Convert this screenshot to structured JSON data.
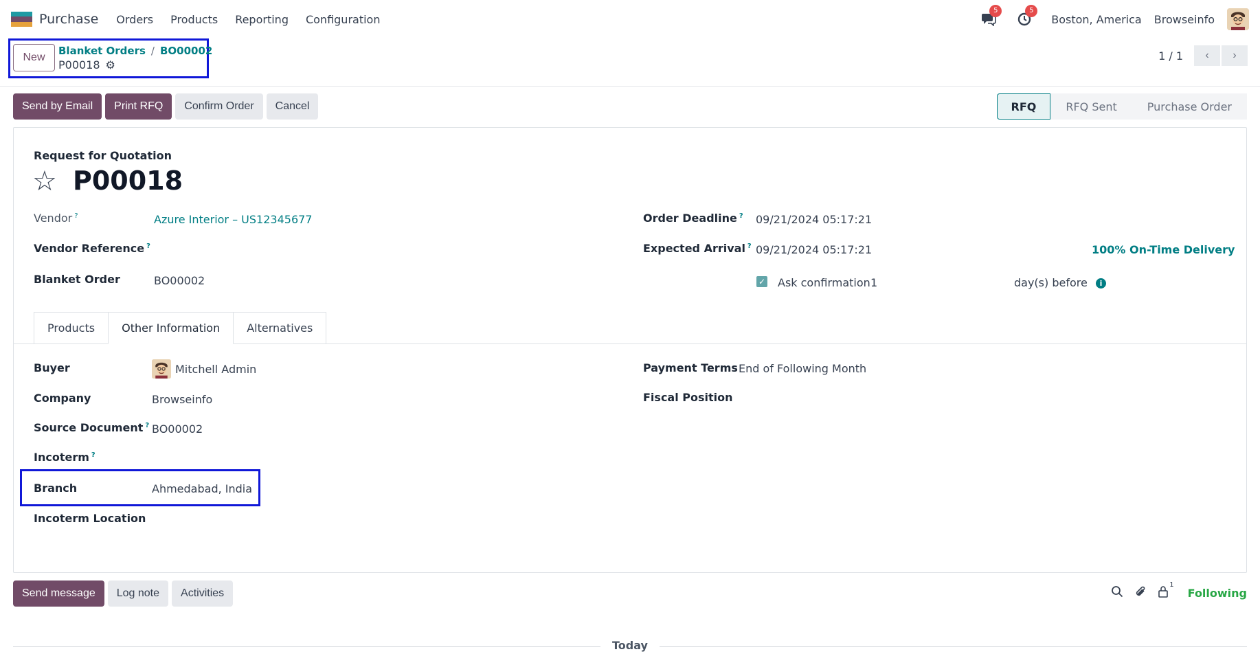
{
  "navbar": {
    "app_name": "Purchase",
    "menu": [
      "Orders",
      "Products",
      "Reporting",
      "Configuration"
    ],
    "messages_badge": "5",
    "activities_badge": "5",
    "location": "Boston, America",
    "company": "Browseinfo",
    "logo_colors": [
      "#1e9aa3",
      "#714b67",
      "#e6a23c"
    ]
  },
  "control": {
    "new_label": "New",
    "breadcrumb_parent": "Blanket Orders",
    "breadcrumb_current": "BO00002",
    "record_name": "P00018",
    "pager": "1 / 1"
  },
  "actions": {
    "send_email": "Send by Email",
    "print_rfq": "Print RFQ",
    "confirm": "Confirm Order",
    "cancel": "Cancel"
  },
  "status": [
    "RFQ",
    "RFQ Sent",
    "Purchase Order"
  ],
  "sheet": {
    "label": "Request for Quotation",
    "title": "P00018",
    "vendor_label": "Vendor",
    "vendor_value": "Azure Interior – US12345677",
    "vendor_ref_label": "Vendor Reference",
    "blanket_label": "Blanket Order",
    "blanket_value": "BO00002",
    "deadline_label": "Order Deadline",
    "deadline_value": "09/21/2024 05:17:21",
    "arrival_label": "Expected Arrival",
    "arrival_value": "09/21/2024 05:17:21",
    "on_time": "100% On-Time Delivery",
    "ask_label": "Ask confirmation",
    "ask_days": "1",
    "days_before": "day(s) before"
  },
  "tabs": [
    "Products",
    "Other Information",
    "Alternatives"
  ],
  "other_info": {
    "buyer_label": "Buyer",
    "buyer_value": "Mitchell Admin",
    "company_label": "Company",
    "company_value": "Browseinfo",
    "source_label": "Source Document",
    "source_value": "BO00002",
    "incoterm_label": "Incoterm",
    "branch_label": "Branch",
    "branch_value": "Ahmedabad, India",
    "incoterm_location_label": "Incoterm Location",
    "payment_terms_label": "Payment Terms",
    "payment_terms_value": "End of Following Month",
    "fiscal_label": "Fiscal Position"
  },
  "chatter": {
    "send_message": "Send message",
    "log_note": "Log note",
    "activities": "Activities",
    "followers_count": "1",
    "following": "Following",
    "today": "Today"
  }
}
